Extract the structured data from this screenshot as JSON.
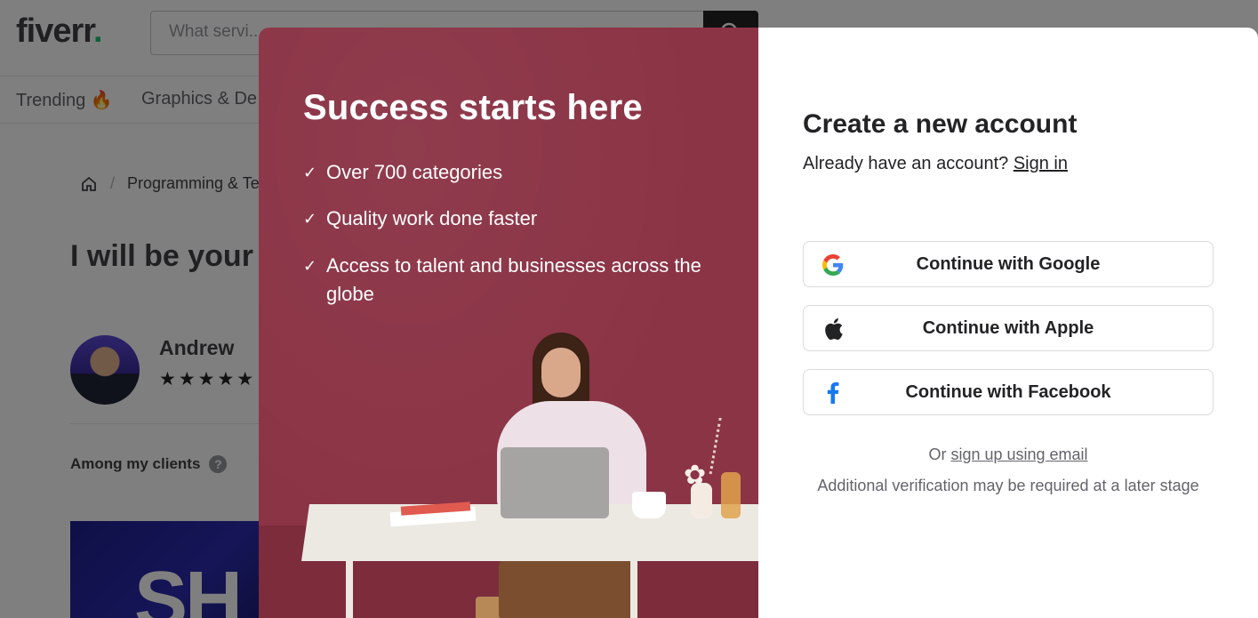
{
  "background_page": {
    "logo_text": "fiverr",
    "logo_dot": ".",
    "search_placeholder": "What servi...",
    "categories": [
      "Trending 🔥",
      "Graphics & De"
    ],
    "breadcrumb": "Programming & Te",
    "gig_title": "I will be your shopify store",
    "seller_name": "Andrew",
    "stars": "★★★★★",
    "clients_label": "Among my clients",
    "help_glyph": "?",
    "promo_text": "SH"
  },
  "modal": {
    "hero_title": "Success starts here",
    "features": [
      "Over 700 categories",
      "Quality work done faster",
      "Access to talent and businesses across the globe"
    ],
    "check_glyph": "✓",
    "laptop_glyph": "",
    "flower_glyph": "✿",
    "form_title": "Create a new account",
    "signin_prompt": "Already have an account?",
    "signin_link": "Sign in",
    "buttons": {
      "google": "Continue with Google",
      "apple": "Continue with Apple",
      "facebook": "Continue with Facebook"
    },
    "or_text": "Or",
    "email_link": "sign up using email",
    "note": "Additional verification may be required at a later stage"
  },
  "colors": {
    "brand_green": "#1dbf73",
    "hero_bg": "#8b3446",
    "google_blue": "#4285f4",
    "google_red": "#ea4335",
    "google_yellow": "#fbbc05",
    "google_green": "#34a853",
    "facebook_blue": "#1877f2"
  },
  "icons": [
    "search-icon",
    "home-icon",
    "help-icon",
    "google-icon",
    "apple-icon",
    "facebook-icon",
    "check-icon"
  ]
}
